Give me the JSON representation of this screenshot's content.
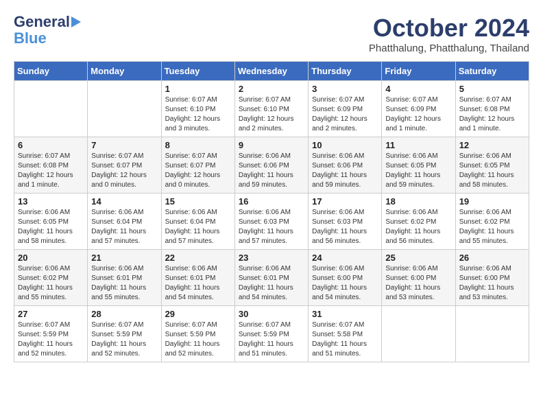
{
  "logo": {
    "line1": "General",
    "line2": "Blue"
  },
  "title": "October 2024",
  "subtitle": "Phatthalung, Phatthalung, Thailand",
  "headers": [
    "Sunday",
    "Monday",
    "Tuesday",
    "Wednesday",
    "Thursday",
    "Friday",
    "Saturday"
  ],
  "weeks": [
    [
      {
        "day": "",
        "info": ""
      },
      {
        "day": "",
        "info": ""
      },
      {
        "day": "1",
        "info": "Sunrise: 6:07 AM\nSunset: 6:10 PM\nDaylight: 12 hours and 3 minutes."
      },
      {
        "day": "2",
        "info": "Sunrise: 6:07 AM\nSunset: 6:10 PM\nDaylight: 12 hours and 2 minutes."
      },
      {
        "day": "3",
        "info": "Sunrise: 6:07 AM\nSunset: 6:09 PM\nDaylight: 12 hours and 2 minutes."
      },
      {
        "day": "4",
        "info": "Sunrise: 6:07 AM\nSunset: 6:09 PM\nDaylight: 12 hours and 1 minute."
      },
      {
        "day": "5",
        "info": "Sunrise: 6:07 AM\nSunset: 6:08 PM\nDaylight: 12 hours and 1 minute."
      }
    ],
    [
      {
        "day": "6",
        "info": "Sunrise: 6:07 AM\nSunset: 6:08 PM\nDaylight: 12 hours and 1 minute."
      },
      {
        "day": "7",
        "info": "Sunrise: 6:07 AM\nSunset: 6:07 PM\nDaylight: 12 hours and 0 minutes."
      },
      {
        "day": "8",
        "info": "Sunrise: 6:07 AM\nSunset: 6:07 PM\nDaylight: 12 hours and 0 minutes."
      },
      {
        "day": "9",
        "info": "Sunrise: 6:06 AM\nSunset: 6:06 PM\nDaylight: 11 hours and 59 minutes."
      },
      {
        "day": "10",
        "info": "Sunrise: 6:06 AM\nSunset: 6:06 PM\nDaylight: 11 hours and 59 minutes."
      },
      {
        "day": "11",
        "info": "Sunrise: 6:06 AM\nSunset: 6:05 PM\nDaylight: 11 hours and 59 minutes."
      },
      {
        "day": "12",
        "info": "Sunrise: 6:06 AM\nSunset: 6:05 PM\nDaylight: 11 hours and 58 minutes."
      }
    ],
    [
      {
        "day": "13",
        "info": "Sunrise: 6:06 AM\nSunset: 6:05 PM\nDaylight: 11 hours and 58 minutes."
      },
      {
        "day": "14",
        "info": "Sunrise: 6:06 AM\nSunset: 6:04 PM\nDaylight: 11 hours and 57 minutes."
      },
      {
        "day": "15",
        "info": "Sunrise: 6:06 AM\nSunset: 6:04 PM\nDaylight: 11 hours and 57 minutes."
      },
      {
        "day": "16",
        "info": "Sunrise: 6:06 AM\nSunset: 6:03 PM\nDaylight: 11 hours and 57 minutes."
      },
      {
        "day": "17",
        "info": "Sunrise: 6:06 AM\nSunset: 6:03 PM\nDaylight: 11 hours and 56 minutes."
      },
      {
        "day": "18",
        "info": "Sunrise: 6:06 AM\nSunset: 6:02 PM\nDaylight: 11 hours and 56 minutes."
      },
      {
        "day": "19",
        "info": "Sunrise: 6:06 AM\nSunset: 6:02 PM\nDaylight: 11 hours and 55 minutes."
      }
    ],
    [
      {
        "day": "20",
        "info": "Sunrise: 6:06 AM\nSunset: 6:02 PM\nDaylight: 11 hours and 55 minutes."
      },
      {
        "day": "21",
        "info": "Sunrise: 6:06 AM\nSunset: 6:01 PM\nDaylight: 11 hours and 55 minutes."
      },
      {
        "day": "22",
        "info": "Sunrise: 6:06 AM\nSunset: 6:01 PM\nDaylight: 11 hours and 54 minutes."
      },
      {
        "day": "23",
        "info": "Sunrise: 6:06 AM\nSunset: 6:01 PM\nDaylight: 11 hours and 54 minutes."
      },
      {
        "day": "24",
        "info": "Sunrise: 6:06 AM\nSunset: 6:00 PM\nDaylight: 11 hours and 54 minutes."
      },
      {
        "day": "25",
        "info": "Sunrise: 6:06 AM\nSunset: 6:00 PM\nDaylight: 11 hours and 53 minutes."
      },
      {
        "day": "26",
        "info": "Sunrise: 6:06 AM\nSunset: 6:00 PM\nDaylight: 11 hours and 53 minutes."
      }
    ],
    [
      {
        "day": "27",
        "info": "Sunrise: 6:07 AM\nSunset: 5:59 PM\nDaylight: 11 hours and 52 minutes."
      },
      {
        "day": "28",
        "info": "Sunrise: 6:07 AM\nSunset: 5:59 PM\nDaylight: 11 hours and 52 minutes."
      },
      {
        "day": "29",
        "info": "Sunrise: 6:07 AM\nSunset: 5:59 PM\nDaylight: 11 hours and 52 minutes."
      },
      {
        "day": "30",
        "info": "Sunrise: 6:07 AM\nSunset: 5:59 PM\nDaylight: 11 hours and 51 minutes."
      },
      {
        "day": "31",
        "info": "Sunrise: 6:07 AM\nSunset: 5:58 PM\nDaylight: 11 hours and 51 minutes."
      },
      {
        "day": "",
        "info": ""
      },
      {
        "day": "",
        "info": ""
      }
    ]
  ]
}
